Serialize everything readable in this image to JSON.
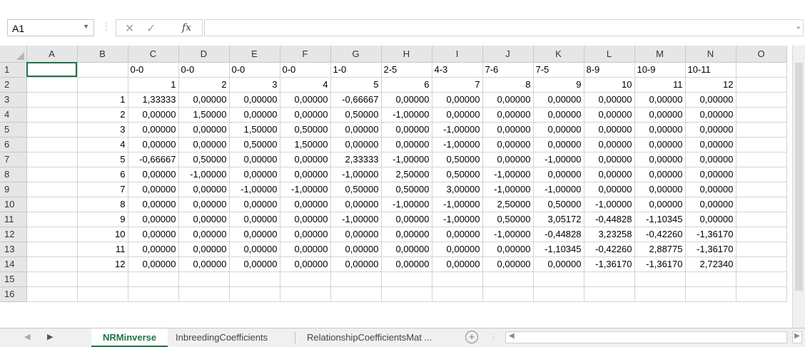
{
  "formula_bar": {
    "name_box": "A1",
    "formula": "",
    "cancel_icon": "close-icon",
    "enter_icon": "check-icon",
    "function_icon": "fx-icon"
  },
  "grid": {
    "columns": [
      "A",
      "B",
      "C",
      "D",
      "E",
      "F",
      "G",
      "H",
      "I",
      "J",
      "K",
      "L",
      "M",
      "N",
      "O"
    ],
    "rows": [
      {
        "n": "1",
        "cells": [
          "",
          "",
          "0-0",
          "0-0",
          "0-0",
          "0-0",
          "1-0",
          "2-5",
          "4-3",
          "7-6",
          "7-5",
          "8-9",
          "10-9",
          "10-11",
          ""
        ]
      },
      {
        "n": "2",
        "cells": [
          "",
          "",
          "1",
          "2",
          "3",
          "4",
          "5",
          "6",
          "7",
          "8",
          "9",
          "10",
          "11",
          "12",
          ""
        ]
      },
      {
        "n": "3",
        "cells": [
          "",
          "1",
          "1,33333",
          "0,00000",
          "0,00000",
          "0,00000",
          "-0,66667",
          "0,00000",
          "0,00000",
          "0,00000",
          "0,00000",
          "0,00000",
          "0,00000",
          "0,00000",
          ""
        ]
      },
      {
        "n": "4",
        "cells": [
          "",
          "2",
          "0,00000",
          "1,50000",
          "0,00000",
          "0,00000",
          "0,50000",
          "-1,00000",
          "0,00000",
          "0,00000",
          "0,00000",
          "0,00000",
          "0,00000",
          "0,00000",
          ""
        ]
      },
      {
        "n": "5",
        "cells": [
          "",
          "3",
          "0,00000",
          "0,00000",
          "1,50000",
          "0,50000",
          "0,00000",
          "0,00000",
          "-1,00000",
          "0,00000",
          "0,00000",
          "0,00000",
          "0,00000",
          "0,00000",
          ""
        ]
      },
      {
        "n": "6",
        "cells": [
          "",
          "4",
          "0,00000",
          "0,00000",
          "0,50000",
          "1,50000",
          "0,00000",
          "0,00000",
          "-1,00000",
          "0,00000",
          "0,00000",
          "0,00000",
          "0,00000",
          "0,00000",
          ""
        ]
      },
      {
        "n": "7",
        "cells": [
          "",
          "5",
          "-0,66667",
          "0,50000",
          "0,00000",
          "0,00000",
          "2,33333",
          "-1,00000",
          "0,50000",
          "0,00000",
          "-1,00000",
          "0,00000",
          "0,00000",
          "0,00000",
          ""
        ]
      },
      {
        "n": "8",
        "cells": [
          "",
          "6",
          "0,00000",
          "-1,00000",
          "0,00000",
          "0,00000",
          "-1,00000",
          "2,50000",
          "0,50000",
          "-1,00000",
          "0,00000",
          "0,00000",
          "0,00000",
          "0,00000",
          ""
        ]
      },
      {
        "n": "9",
        "cells": [
          "",
          "7",
          "0,00000",
          "0,00000",
          "-1,00000",
          "-1,00000",
          "0,50000",
          "0,50000",
          "3,00000",
          "-1,00000",
          "-1,00000",
          "0,00000",
          "0,00000",
          "0,00000",
          ""
        ]
      },
      {
        "n": "10",
        "cells": [
          "",
          "8",
          "0,00000",
          "0,00000",
          "0,00000",
          "0,00000",
          "0,00000",
          "-1,00000",
          "-1,00000",
          "2,50000",
          "0,50000",
          "-1,00000",
          "0,00000",
          "0,00000",
          ""
        ]
      },
      {
        "n": "11",
        "cells": [
          "",
          "9",
          "0,00000",
          "0,00000",
          "0,00000",
          "0,00000",
          "-1,00000",
          "0,00000",
          "-1,00000",
          "0,50000",
          "3,05172",
          "-0,44828",
          "-1,10345",
          "0,00000",
          ""
        ]
      },
      {
        "n": "12",
        "cells": [
          "",
          "10",
          "0,00000",
          "0,00000",
          "0,00000",
          "0,00000",
          "0,00000",
          "0,00000",
          "0,00000",
          "-1,00000",
          "-0,44828",
          "3,23258",
          "-0,42260",
          "-1,36170",
          ""
        ]
      },
      {
        "n": "13",
        "cells": [
          "",
          "11",
          "0,00000",
          "0,00000",
          "0,00000",
          "0,00000",
          "0,00000",
          "0,00000",
          "0,00000",
          "0,00000",
          "-1,10345",
          "-0,42260",
          "2,88775",
          "-1,36170",
          ""
        ]
      },
      {
        "n": "14",
        "cells": [
          "",
          "12",
          "0,00000",
          "0,00000",
          "0,00000",
          "0,00000",
          "0,00000",
          "0,00000",
          "0,00000",
          "0,00000",
          "0,00000",
          "-1,36170",
          "-1,36170",
          "2,72340",
          ""
        ]
      },
      {
        "n": "15",
        "cells": [
          "",
          "",
          "",
          "",
          "",
          "",
          "",
          "",
          "",
          "",
          "",
          "",
          "",
          "",
          ""
        ]
      },
      {
        "n": "16",
        "cells": [
          "",
          "",
          "",
          "",
          "",
          "",
          "",
          "",
          "",
          "",
          "",
          "",
          "",
          "",
          ""
        ]
      }
    ]
  },
  "tabs": {
    "sheets": [
      "NRMinverse",
      "InbreedingCoefficients",
      "RelationshipCoefficientsMat ..."
    ],
    "active_index": 0,
    "add_sheet_label": "+"
  },
  "colors": {
    "accent": "#217346",
    "header_bg": "#e6e6e6",
    "gridline": "#d4d4d4"
  }
}
